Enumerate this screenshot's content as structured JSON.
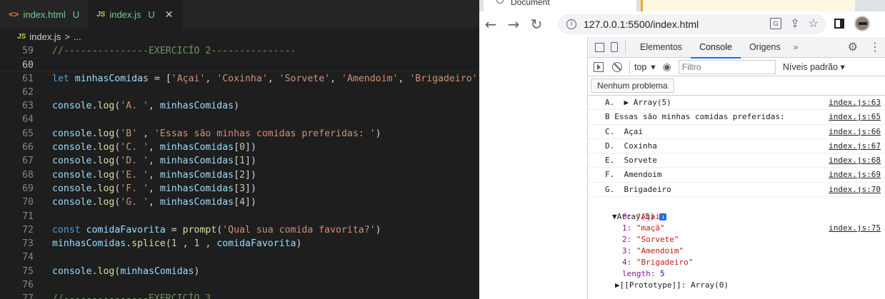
{
  "editor": {
    "tabs": [
      {
        "icon": "<>",
        "name": "index.html",
        "status": "U"
      },
      {
        "icon": "JS",
        "name": "index.js",
        "status": "U",
        "close": "✕"
      }
    ],
    "breadcrumb": {
      "icon": "JS",
      "file": "index.js",
      "sep": ">",
      "rest": "..."
    },
    "lines": [
      {
        "n": "59",
        "tokens": [
          {
            "t": "//---------------EXERCICÍO 2---------------",
            "c": "cm"
          }
        ]
      },
      {
        "n": "60",
        "tokens": []
      },
      {
        "n": "61",
        "tokens": [
          {
            "t": "let",
            "c": "kw"
          },
          {
            "t": " "
          },
          {
            "t": "minhasComidas",
            "c": "var"
          },
          {
            "t": " = ["
          },
          {
            "t": "'Açai'",
            "c": "str"
          },
          {
            "t": ", "
          },
          {
            "t": "'Coxinha'",
            "c": "str"
          },
          {
            "t": ", "
          },
          {
            "t": "'Sorvete'",
            "c": "str"
          },
          {
            "t": ", "
          },
          {
            "t": "'Amendoim'",
            "c": "str"
          },
          {
            "t": ", "
          },
          {
            "t": "'Brigadeiro'",
            "c": "str"
          },
          {
            "t": "]"
          }
        ]
      },
      {
        "n": "62",
        "tokens": []
      },
      {
        "n": "63",
        "tokens": [
          {
            "t": "console",
            "c": "var"
          },
          {
            "t": "."
          },
          {
            "t": "log",
            "c": "fn"
          },
          {
            "t": "("
          },
          {
            "t": "'A. '",
            "c": "str"
          },
          {
            "t": ", "
          },
          {
            "t": "minhasComidas",
            "c": "var"
          },
          {
            "t": ")"
          }
        ]
      },
      {
        "n": "64",
        "tokens": []
      },
      {
        "n": "65",
        "tokens": [
          {
            "t": "console",
            "c": "var"
          },
          {
            "t": "."
          },
          {
            "t": "log",
            "c": "fn"
          },
          {
            "t": "("
          },
          {
            "t": "'B'",
            "c": "str"
          },
          {
            "t": " , "
          },
          {
            "t": "'Essas são minhas comidas preferidas: '",
            "c": "str"
          },
          {
            "t": ")"
          }
        ]
      },
      {
        "n": "66",
        "tokens": [
          {
            "t": "console",
            "c": "var"
          },
          {
            "t": "."
          },
          {
            "t": "log",
            "c": "fn"
          },
          {
            "t": "("
          },
          {
            "t": "'C. '",
            "c": "str"
          },
          {
            "t": ", "
          },
          {
            "t": "minhasComidas",
            "c": "var"
          },
          {
            "t": "["
          },
          {
            "t": "0",
            "c": "num"
          },
          {
            "t": "])"
          }
        ]
      },
      {
        "n": "67",
        "tokens": [
          {
            "t": "console",
            "c": "var"
          },
          {
            "t": "."
          },
          {
            "t": "log",
            "c": "fn"
          },
          {
            "t": "("
          },
          {
            "t": "'D. '",
            "c": "str"
          },
          {
            "t": ", "
          },
          {
            "t": "minhasComidas",
            "c": "var"
          },
          {
            "t": "["
          },
          {
            "t": "1",
            "c": "num"
          },
          {
            "t": "])"
          }
        ]
      },
      {
        "n": "68",
        "tokens": [
          {
            "t": "console",
            "c": "var"
          },
          {
            "t": "."
          },
          {
            "t": "log",
            "c": "fn"
          },
          {
            "t": "("
          },
          {
            "t": "'E. '",
            "c": "str"
          },
          {
            "t": ", "
          },
          {
            "t": "minhasComidas",
            "c": "var"
          },
          {
            "t": "["
          },
          {
            "t": "2",
            "c": "num"
          },
          {
            "t": "])"
          }
        ]
      },
      {
        "n": "69",
        "tokens": [
          {
            "t": "console",
            "c": "var"
          },
          {
            "t": "."
          },
          {
            "t": "log",
            "c": "fn"
          },
          {
            "t": "("
          },
          {
            "t": "'F. '",
            "c": "str"
          },
          {
            "t": ", "
          },
          {
            "t": "minhasComidas",
            "c": "var"
          },
          {
            "t": "["
          },
          {
            "t": "3",
            "c": "num"
          },
          {
            "t": "])"
          }
        ]
      },
      {
        "n": "70",
        "tokens": [
          {
            "t": "console",
            "c": "var"
          },
          {
            "t": "."
          },
          {
            "t": "log",
            "c": "fn"
          },
          {
            "t": "("
          },
          {
            "t": "'G. '",
            "c": "str"
          },
          {
            "t": ", "
          },
          {
            "t": "minhasComidas",
            "c": "var"
          },
          {
            "t": "["
          },
          {
            "t": "4",
            "c": "num"
          },
          {
            "t": "])"
          }
        ]
      },
      {
        "n": "71",
        "tokens": []
      },
      {
        "n": "72",
        "tokens": [
          {
            "t": "const",
            "c": "kw"
          },
          {
            "t": " "
          },
          {
            "t": "comidaFavorita",
            "c": "var"
          },
          {
            "t": " = "
          },
          {
            "t": "prompt",
            "c": "fn"
          },
          {
            "t": "("
          },
          {
            "t": "'Qual sua comida favorita?'",
            "c": "str"
          },
          {
            "t": ")"
          }
        ]
      },
      {
        "n": "73",
        "tokens": [
          {
            "t": "minhasComidas",
            "c": "var"
          },
          {
            "t": "."
          },
          {
            "t": "splice",
            "c": "fn"
          },
          {
            "t": "("
          },
          {
            "t": "1",
            "c": "num"
          },
          {
            "t": " , "
          },
          {
            "t": "1",
            "c": "num"
          },
          {
            "t": " , "
          },
          {
            "t": "comidaFavorita",
            "c": "var"
          },
          {
            "t": ")"
          }
        ]
      },
      {
        "n": "74",
        "tokens": []
      },
      {
        "n": "75",
        "tokens": [
          {
            "t": "console",
            "c": "var"
          },
          {
            "t": "."
          },
          {
            "t": "log",
            "c": "fn"
          },
          {
            "t": "("
          },
          {
            "t": "minhasComidas",
            "c": "var"
          },
          {
            "t": ")"
          }
        ]
      },
      {
        "n": "76",
        "tokens": []
      },
      {
        "n": "77",
        "tokens": [
          {
            "t": "//---------------EXERCICÍO 3",
            "c": "cm"
          }
        ]
      }
    ]
  },
  "browser": {
    "tab_title": "Document",
    "url": "127.0.0.1:5500/index.html",
    "devtools": {
      "tabs": [
        "Elementos",
        "Console",
        "Origens"
      ],
      "more": "»",
      "context": "top",
      "filter_placeholder": "Filtro",
      "levels": "Níveis padrão",
      "issues": "Nenhum problema",
      "messages": [
        {
          "text": "A.  ▶ Array(5)",
          "src": "index.js:63"
        },
        {
          "text": "B Essas são minhas comidas preferidas:",
          "src": "index.js:65"
        },
        {
          "text": "C.  Açai",
          "src": "index.js:66"
        },
        {
          "text": "D.  Coxinha",
          "src": "index.js:67"
        },
        {
          "text": "E.  Sorvete",
          "src": "index.js:68"
        },
        {
          "text": "F.  Amendoim",
          "src": "index.js:69"
        },
        {
          "text": "G.  Brigadeiro",
          "src": "index.js:70"
        }
      ],
      "expanded": {
        "header": "▼Array(5)",
        "info": "i",
        "src": "index.js:75",
        "items": [
          {
            "k": "0:",
            "v": "\"Açai\""
          },
          {
            "k": "1:",
            "v": "\"maçã\""
          },
          {
            "k": "2:",
            "v": "\"Sorvete\""
          },
          {
            "k": "3:",
            "v": "\"Amendoim\""
          },
          {
            "k": "4:",
            "v": "\"Brigadeiro\""
          }
        ],
        "length_key": "length:",
        "length_val": "5",
        "proto": "▶[[Prototype]]: Array(0)"
      }
    }
  }
}
